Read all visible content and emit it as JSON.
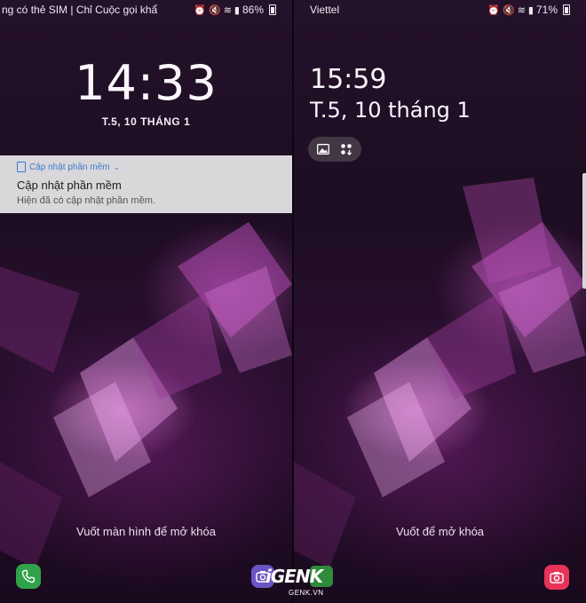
{
  "left_screen": {
    "status_text": "ng có thẻ SIM | Chỉ Cuộc gọi khẩ",
    "battery": "86%",
    "clock": "14:33",
    "date": "T.5, 10 THÁNG 1",
    "notification": {
      "app_label": "Cập nhật phần mềm",
      "title": "Cập nhật phần mềm",
      "body": "Hiện đã có cập nhật phần mềm."
    },
    "swipe_hint": "Vuốt màn hình để mở khóa",
    "shortcut_left_icon": "phone-icon",
    "shortcut_right_icon": "camera-icon"
  },
  "right_screen": {
    "carrier": "Viettel",
    "battery": "71%",
    "clock": "15:59",
    "date": "T.5, 10 tháng 1",
    "pill_icons": [
      "gallery-icon",
      "apps-download-icon"
    ],
    "swipe_hint": "Vuốt để mở khóa",
    "shortcut_right_icon": "camera-icon"
  },
  "watermark": {
    "brand": "iGENK",
    "site": "GENK.VN"
  },
  "colors": {
    "notification_accent": "#3a7bd5",
    "phone_green": "#2fa24a",
    "camera_red": "#e83358",
    "camera_purple": "#6b55c4"
  }
}
